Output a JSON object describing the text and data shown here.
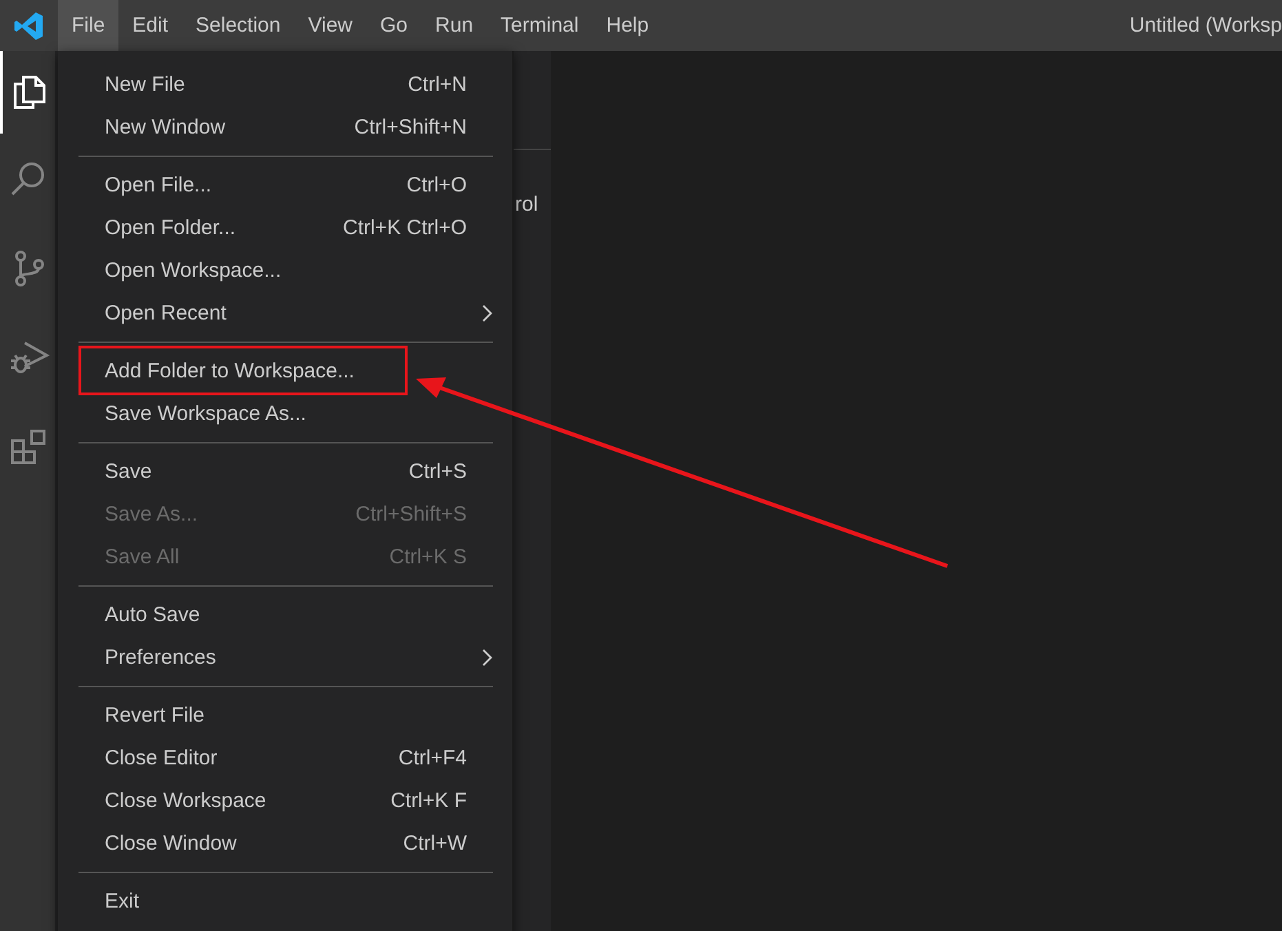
{
  "menubar": {
    "items": [
      {
        "label": "File",
        "selected": true
      },
      {
        "label": "Edit",
        "selected": false
      },
      {
        "label": "Selection",
        "selected": false
      },
      {
        "label": "View",
        "selected": false
      },
      {
        "label": "Go",
        "selected": false
      },
      {
        "label": "Run",
        "selected": false
      },
      {
        "label": "Terminal",
        "selected": false
      },
      {
        "label": "Help",
        "selected": false
      }
    ]
  },
  "window_title": "Untitled (Worksp",
  "activity_bar": [
    {
      "kind": "explorer",
      "selected": true
    },
    {
      "kind": "search",
      "selected": false
    },
    {
      "kind": "source-control",
      "selected": false
    },
    {
      "kind": "run",
      "selected": false
    },
    {
      "kind": "extensions",
      "selected": false
    }
  ],
  "sidebar": {
    "partial_text": "rol"
  },
  "file_menu": {
    "groups": [
      [
        {
          "label": "New File",
          "shortcut": "Ctrl+N",
          "disabled": false,
          "submenu": false,
          "highlighted": false
        },
        {
          "label": "New Window",
          "shortcut": "Ctrl+Shift+N",
          "disabled": false,
          "submenu": false,
          "highlighted": false
        }
      ],
      [
        {
          "label": "Open File...",
          "shortcut": "Ctrl+O",
          "disabled": false,
          "submenu": false,
          "highlighted": false
        },
        {
          "label": "Open Folder...",
          "shortcut": "Ctrl+K Ctrl+O",
          "disabled": false,
          "submenu": false,
          "highlighted": false
        },
        {
          "label": "Open Workspace...",
          "disabled": false,
          "submenu": false,
          "highlighted": false
        },
        {
          "label": "Open Recent",
          "disabled": false,
          "submenu": true,
          "highlighted": false
        }
      ],
      [
        {
          "label": "Add Folder to Workspace...",
          "disabled": false,
          "submenu": false,
          "highlighted": true
        },
        {
          "label": "Save Workspace As...",
          "disabled": false,
          "submenu": false,
          "highlighted": false
        }
      ],
      [
        {
          "label": "Save",
          "shortcut": "Ctrl+S",
          "disabled": false,
          "submenu": false,
          "highlighted": false
        },
        {
          "label": "Save As...",
          "shortcut": "Ctrl+Shift+S",
          "disabled": true,
          "submenu": false,
          "highlighted": false
        },
        {
          "label": "Save All",
          "shortcut": "Ctrl+K S",
          "disabled": true,
          "submenu": false,
          "highlighted": false
        }
      ],
      [
        {
          "label": "Auto Save",
          "disabled": false,
          "submenu": false,
          "highlighted": false
        },
        {
          "label": "Preferences",
          "disabled": false,
          "submenu": true,
          "highlighted": false
        }
      ],
      [
        {
          "label": "Revert File",
          "disabled": false,
          "submenu": false,
          "highlighted": false
        },
        {
          "label": "Close Editor",
          "shortcut": "Ctrl+F4",
          "disabled": false,
          "submenu": false,
          "highlighted": false
        },
        {
          "label": "Close Workspace",
          "shortcut": "Ctrl+K F",
          "disabled": false,
          "submenu": false,
          "highlighted": false
        },
        {
          "label": "Close Window",
          "shortcut": "Ctrl+W",
          "disabled": false,
          "submenu": false,
          "highlighted": false
        }
      ],
      [
        {
          "label": "Exit",
          "disabled": false,
          "submenu": false,
          "highlighted": false
        }
      ]
    ]
  }
}
